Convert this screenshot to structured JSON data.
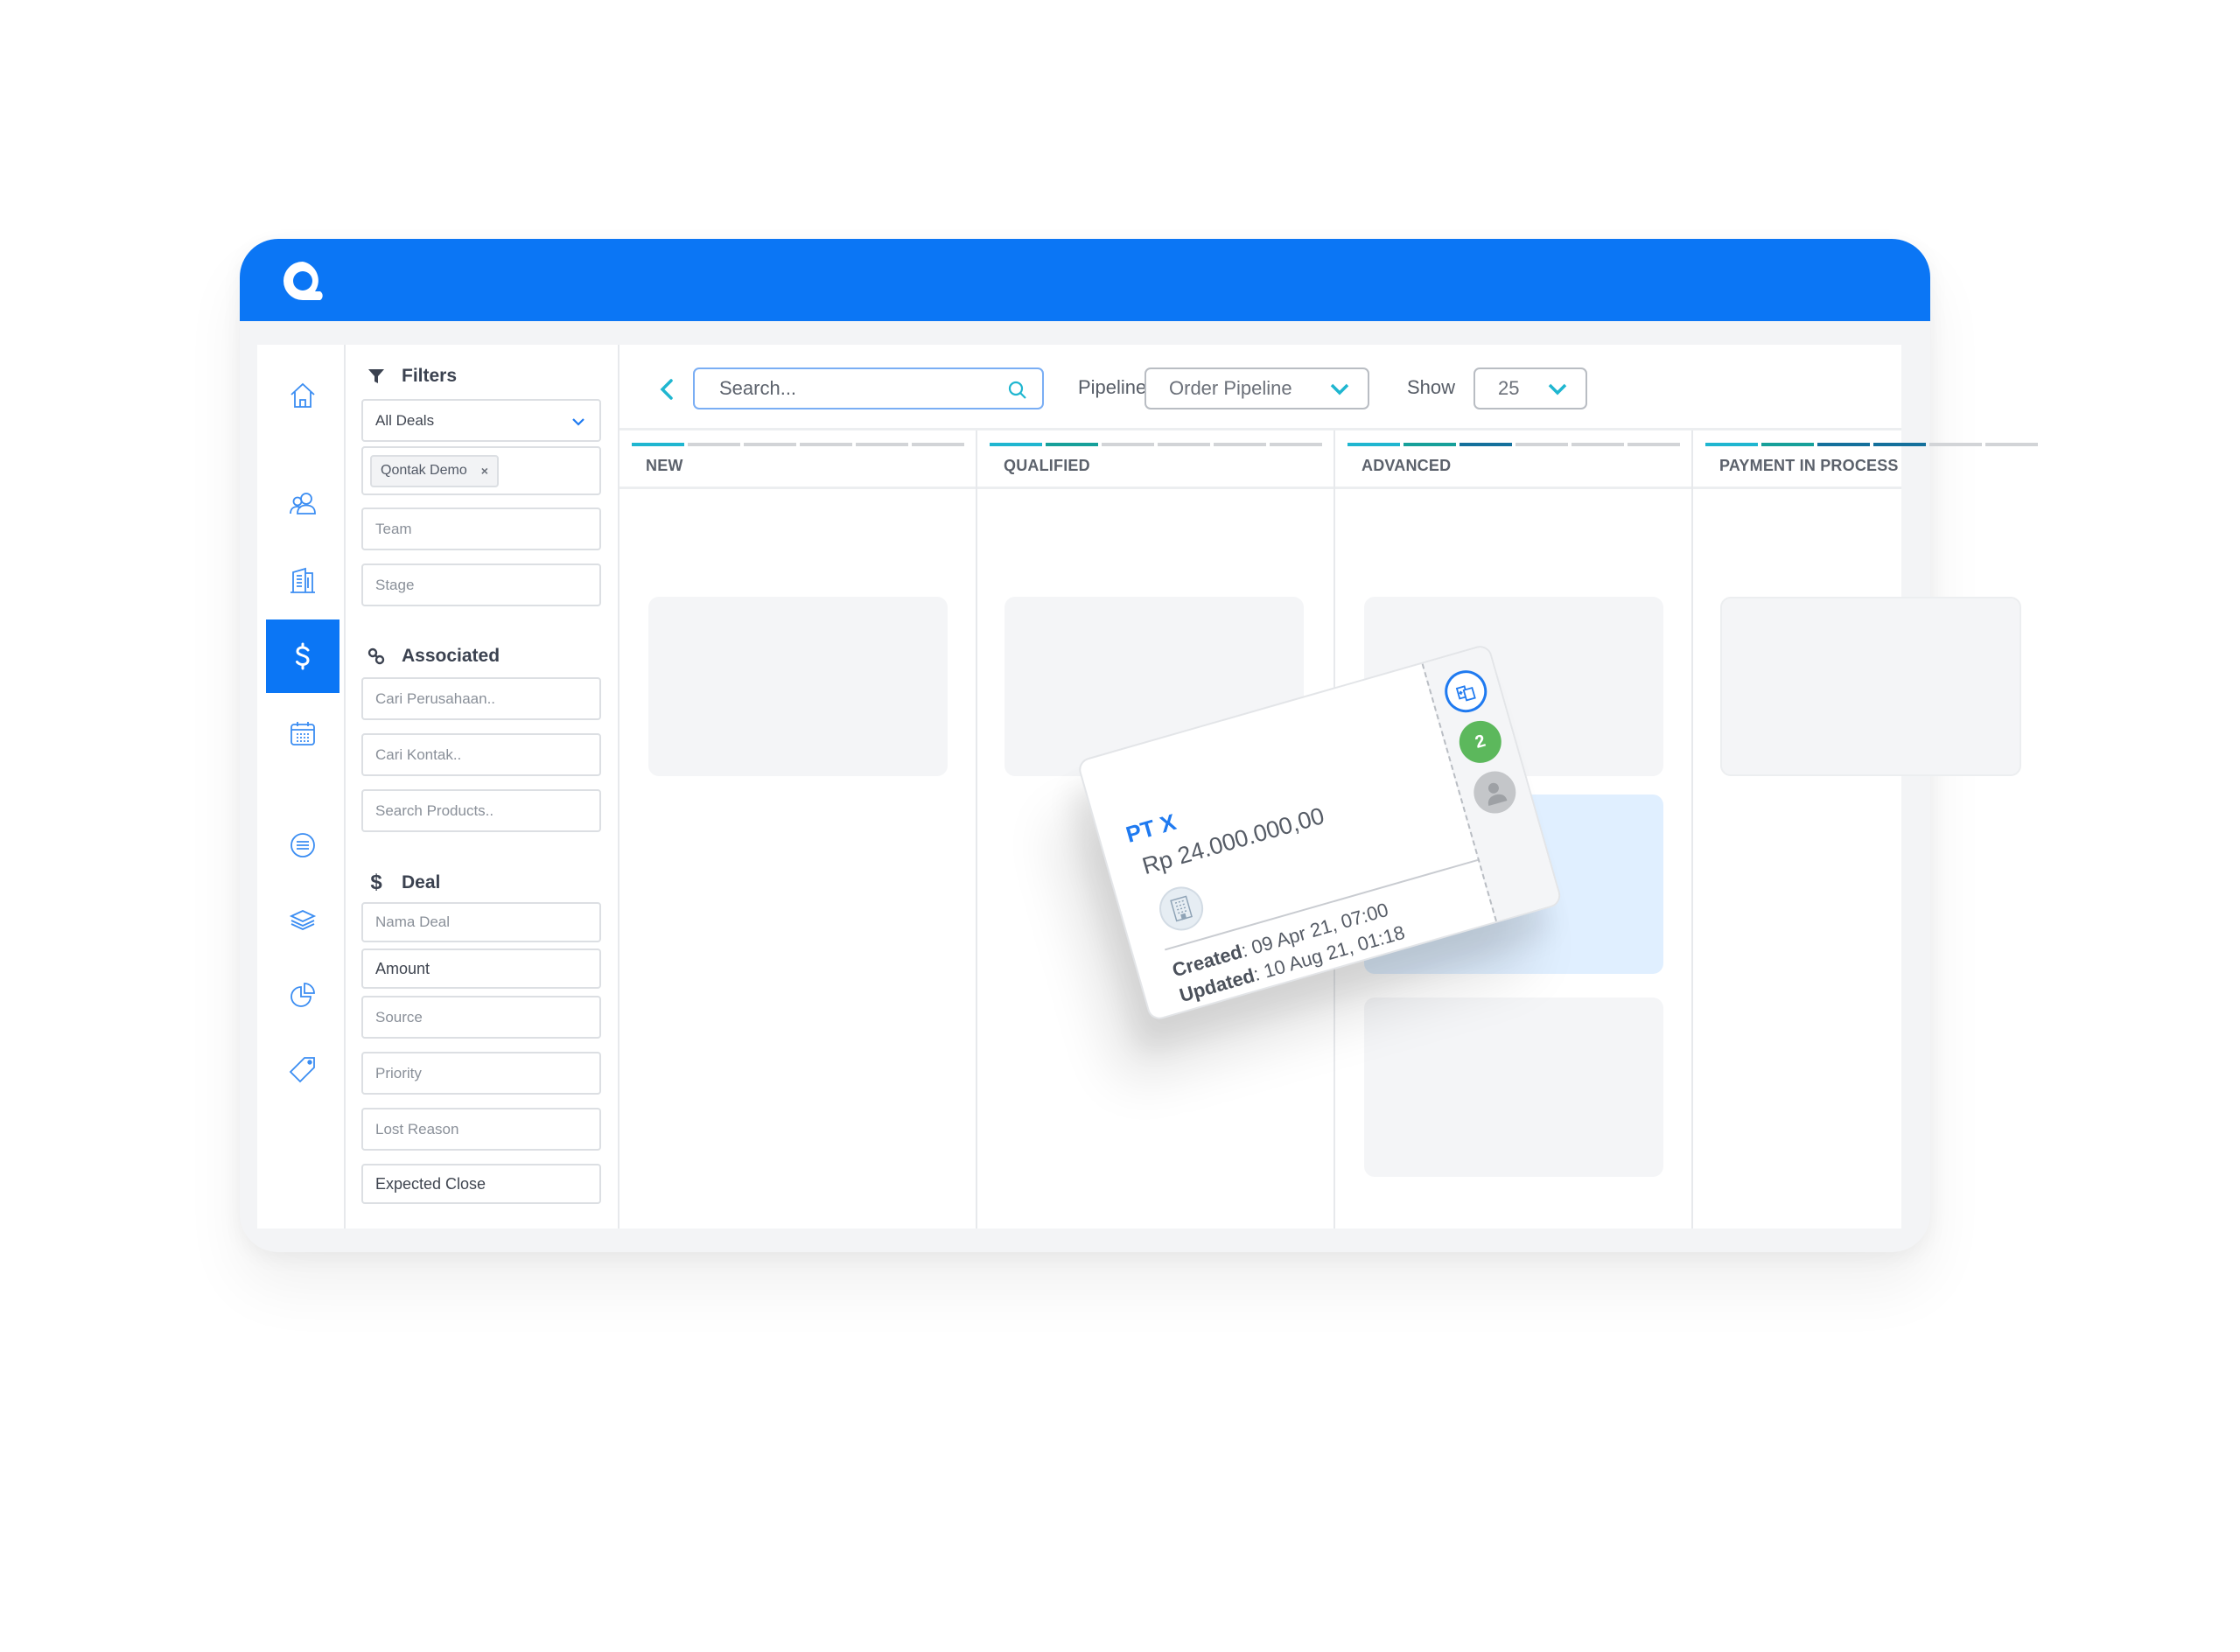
{
  "app": {
    "logo_icon": "qontak-logo",
    "brand_color": "#0b76f5"
  },
  "rail": {
    "items": [
      {
        "name": "home",
        "icon": "home-icon",
        "active": false
      },
      {
        "name": "contacts",
        "icon": "people-icon",
        "active": false
      },
      {
        "name": "companies",
        "icon": "building-icon",
        "active": false
      },
      {
        "name": "deals",
        "icon": "dollar-icon",
        "active": true
      },
      {
        "name": "calendar",
        "icon": "calendar-icon",
        "active": false
      },
      {
        "name": "tasks",
        "icon": "list-circle-icon",
        "active": false
      },
      {
        "name": "products",
        "icon": "layers-icon",
        "active": false
      },
      {
        "name": "reports",
        "icon": "pie-chart-icon",
        "active": false
      },
      {
        "name": "tags",
        "icon": "tag-icon",
        "active": false
      }
    ]
  },
  "filters": {
    "title": "Filters",
    "deal_scope": "All Deals",
    "owner_chip": "Qontak Demo",
    "owner_chip_remove": "×",
    "team_placeholder": "Team",
    "stage_placeholder": "Stage",
    "associated": {
      "title": "Associated",
      "company_placeholder": "Cari Perusahaan..",
      "contact_placeholder": "Cari Kontak..",
      "product_placeholder": "Search Products.."
    },
    "deal": {
      "title": "Deal",
      "name_placeholder": "Nama Deal",
      "amount": "Amount",
      "source": "Source",
      "priority": "Priority",
      "lost_reason": "Lost Reason",
      "expected_close": "Expected Close"
    }
  },
  "toolbar": {
    "search_placeholder": "Search...",
    "pipeline_label": "Pipeline",
    "pipeline_value": "Order Pipeline",
    "show_label": "Show",
    "show_value": "25"
  },
  "stage_colors": [
    "#1fb6d0",
    "#16a09a",
    "#14709c",
    "#14709c",
    "#d2d4d7",
    "#d2d4d7"
  ],
  "columns": [
    {
      "title": "NEW",
      "progress_filled": 1,
      "progress_total": 6
    },
    {
      "title": "QUALIFIED",
      "progress_filled": 2,
      "progress_total": 6
    },
    {
      "title": "ADVANCED",
      "progress_filled": 3,
      "progress_total": 6
    },
    {
      "title": "PAYMENT IN PROCESS",
      "progress_filled": 4,
      "progress_total": 6
    }
  ],
  "deal_card": {
    "name": "PT X",
    "amount": "Rp 24.000.000,00",
    "created_label": "Created",
    "created_value": ": 09 Apr 21, 07:00",
    "updated_label": "Updated",
    "updated_value": ": 10 Aug 21, 01:18",
    "count_badge": "2",
    "name_color": "#1f7af0",
    "badge_color": "#5cb85c"
  }
}
